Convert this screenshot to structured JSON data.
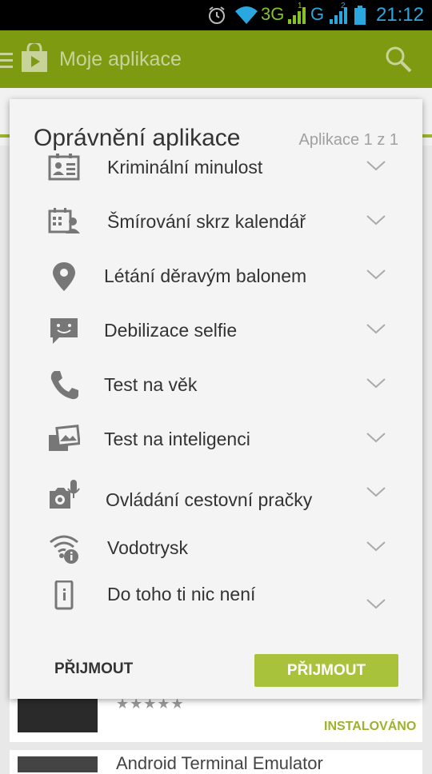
{
  "status_bar": {
    "network_1": "3G",
    "network_2": "G",
    "sim_1": "1",
    "sim_2": "2",
    "time": "21:12",
    "icons": [
      "alarm-icon",
      "wifi-icon",
      "signal-icon",
      "signal-icon",
      "battery-icon"
    ]
  },
  "app_bar": {
    "title": "Moje aplikace",
    "icons": [
      "menu-icon",
      "play-store-icon",
      "search-icon"
    ]
  },
  "background": {
    "stars": "★★★★★",
    "installed_label": "INSTALOVÁNO",
    "next_app": "Android Terminal Emulator"
  },
  "dialog": {
    "title": "Oprávnění aplikace",
    "counter": "Aplikace 1 z 1",
    "permissions": [
      {
        "label": "Kriminální minulost",
        "icon": "id-card-icon"
      },
      {
        "label": "Šmírování skrz kalendář",
        "icon": "calendar-contact-icon"
      },
      {
        "label": "Létání děravým balonem",
        "icon": "location-pin-icon"
      },
      {
        "label": "Debilizace selfie",
        "icon": "message-icon"
      },
      {
        "label": "Test na věk",
        "icon": "phone-icon"
      },
      {
        "label": "Test na inteligenci",
        "icon": "photos-icon"
      },
      {
        "label": "Ovládání cestovní pračky",
        "icon": "camera-mic-icon"
      },
      {
        "label": "Vodotrysk",
        "icon": "wifi-info-icon"
      },
      {
        "label": "Do toho ti nic není",
        "icon": "device-info-icon"
      }
    ],
    "cancel_label": "PŘIJMOUT",
    "accept_label": "PŘIJMOUT"
  },
  "colors": {
    "app_bar": "#7e9a10",
    "accent": "#a9c23c",
    "status_text": "#2aa7df",
    "dialog_bg": "#f4f4f4"
  }
}
